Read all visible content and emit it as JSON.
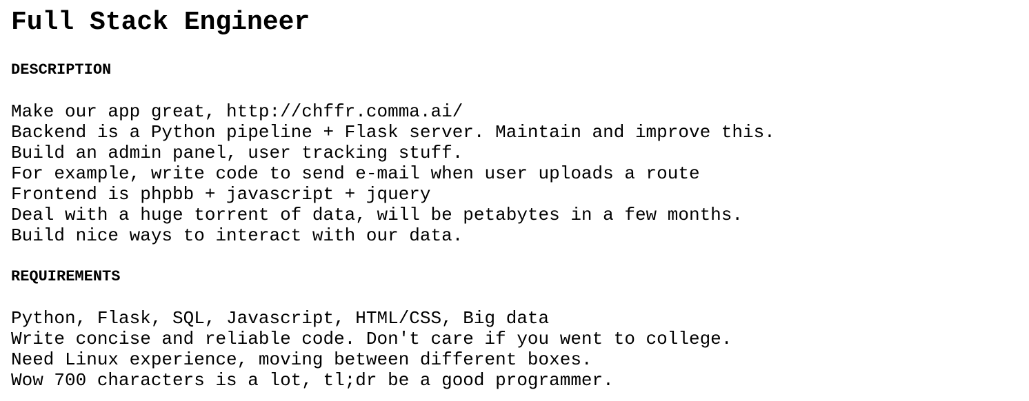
{
  "title": "Full Stack Engineer",
  "sections": {
    "description": {
      "heading": "DESCRIPTION",
      "lines": [
        "Make our app great, http://chffr.comma.ai/",
        "Backend is a Python pipeline + Flask server. Maintain and improve this.",
        "Build an admin panel, user tracking stuff.",
        "For example, write code to send e-mail when user uploads a route",
        "Frontend is phpbb + javascript + jquery",
        "Deal with a huge torrent of data, will be petabytes in a few months.",
        "Build nice ways to interact with our data."
      ]
    },
    "requirements": {
      "heading": "REQUIREMENTS",
      "lines": [
        "Python, Flask, SQL, Javascript, HTML/CSS, Big data",
        "Write concise and reliable code. Don't care if you went to college.",
        "Need Linux experience, moving between different boxes.",
        "Wow 700 characters is a lot, tl;dr be a good programmer."
      ]
    }
  }
}
